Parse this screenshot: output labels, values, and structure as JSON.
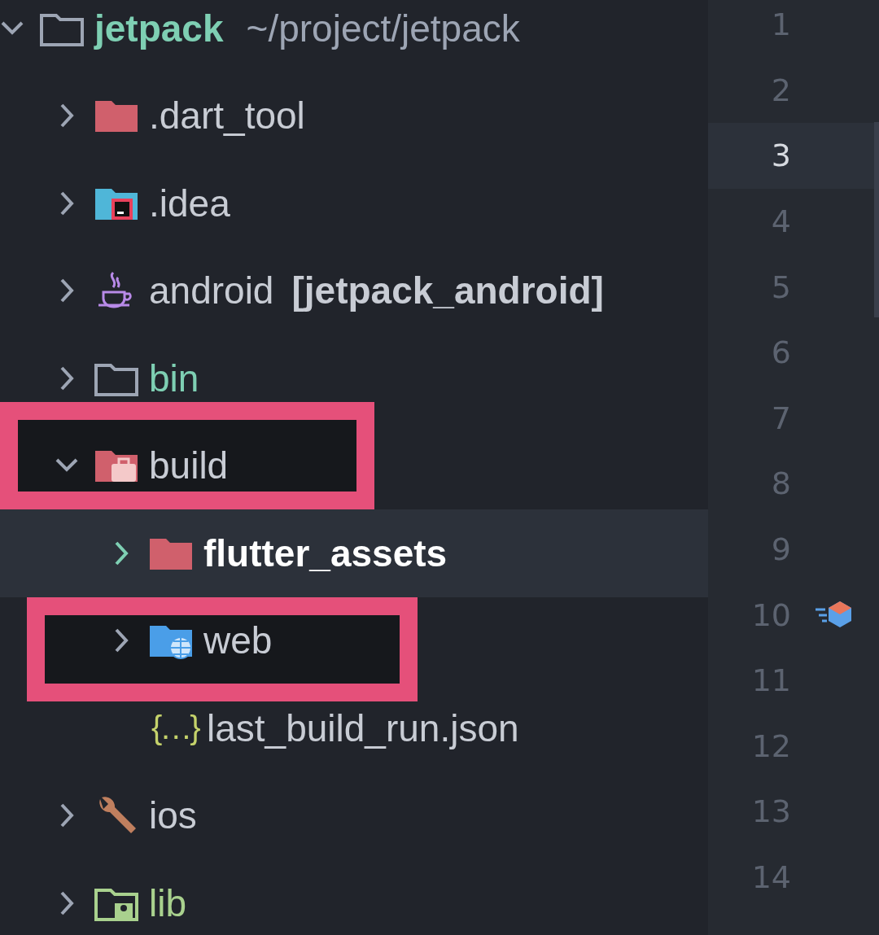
{
  "tree": [
    {
      "name": "jetpack",
      "suffix": "~/project/jetpack",
      "kind": "folder-outline",
      "color": "#7ecfb3",
      "bold": true,
      "expanded": true,
      "selected": false,
      "highlighted": false,
      "children": [
        {
          "name": ".dart_tool",
          "kind": "folder-red",
          "color": "#c8ccd4",
          "bold": false,
          "expanded": false,
          "selected": false,
          "highlighted": false
        },
        {
          "name": ".idea",
          "kind": "folder-idea",
          "color": "#c8ccd4",
          "bold": false,
          "expanded": false,
          "selected": false,
          "highlighted": false
        },
        {
          "name": "android",
          "suffix": "[jetpack_android]",
          "kind": "cup",
          "color": "#c8ccd4",
          "bold": false,
          "expanded": false,
          "selected": false,
          "highlighted": false
        },
        {
          "name": "bin",
          "kind": "folder-outline",
          "color": "#7ecfb3",
          "bold": false,
          "expanded": false,
          "selected": false,
          "highlighted": false
        },
        {
          "name": "build",
          "kind": "folder-build",
          "color": "#c8ccd4",
          "bold": false,
          "expanded": true,
          "selected": false,
          "highlighted": true,
          "children": [
            {
              "name": "flutter_assets",
              "kind": "folder-red",
              "color": "#ffffff",
              "bold": true,
              "expanded": false,
              "selected": true,
              "highlighted": false
            },
            {
              "name": "web",
              "kind": "folder-web",
              "color": "#c8ccd4",
              "bold": false,
              "expanded": false,
              "selected": false,
              "highlighted": true
            },
            {
              "name": "last_build_run.json",
              "kind": "json",
              "icon_text": "{…}",
              "color": "#c8ccd4",
              "bold": false,
              "selected": false,
              "highlighted": false
            }
          ]
        },
        {
          "name": "ios",
          "kind": "wrench",
          "color": "#c8ccd4",
          "bold": false,
          "expanded": false,
          "selected": false,
          "highlighted": false
        },
        {
          "name": "lib",
          "kind": "folder-lib",
          "color": "#a9d18e",
          "bold": false,
          "expanded": false,
          "selected": false,
          "highlighted": false
        }
      ]
    }
  ],
  "gutter": {
    "lines": [
      {
        "number": "1",
        "current": false
      },
      {
        "number": "2",
        "current": false
      },
      {
        "number": "3",
        "current": true
      },
      {
        "number": "4",
        "current": false
      },
      {
        "number": "5",
        "current": false
      },
      {
        "number": "6",
        "current": false
      },
      {
        "number": "7",
        "current": false
      },
      {
        "number": "8",
        "current": false
      },
      {
        "number": "9",
        "current": false
      },
      {
        "number": "10",
        "current": false,
        "marker": true
      },
      {
        "number": "11",
        "current": false
      },
      {
        "number": "12",
        "current": false
      },
      {
        "number": "13",
        "current": false
      },
      {
        "number": "14",
        "current": false
      }
    ]
  }
}
